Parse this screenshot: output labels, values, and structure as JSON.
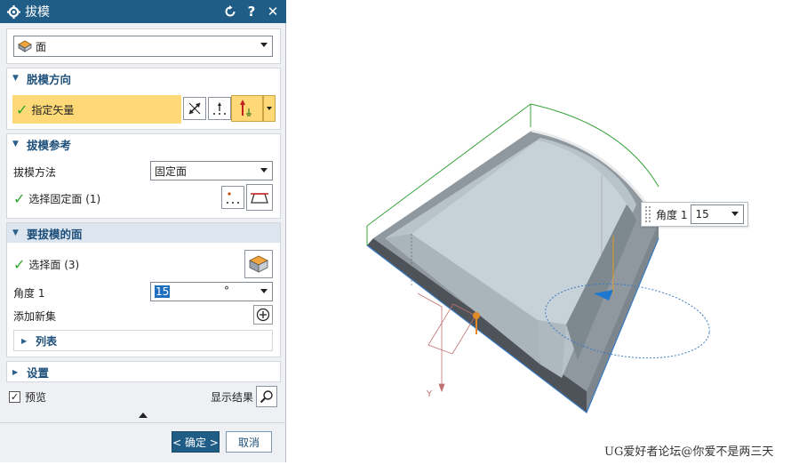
{
  "dialog": {
    "title": "拔模",
    "type_select": {
      "value": "面",
      "icon": "face-icon"
    },
    "draft_direction": {
      "header": "脱模方向",
      "specify_vector": "指定矢量",
      "icons": [
        "reverse-direction-icon",
        "vector-dialog-icon",
        "zc-axis-icon"
      ]
    },
    "draft_reference": {
      "header": "拔模参考",
      "method_label": "拔模方法",
      "method_value": "固定面",
      "select_fixed_face": "选择固定面 (1)"
    },
    "faces_to_draft": {
      "header": "要拔模的面",
      "select_face": "选择面 (3)",
      "angle_label": "角度 1",
      "angle_value": "15",
      "angle_unit": "°",
      "add_new_set": "添加新集",
      "list_label": "列表"
    },
    "settings": {
      "header": "设置"
    },
    "preview": {
      "label": "预览",
      "checked": true
    },
    "show_result": "显示结果",
    "ok_label": "< 确定 >",
    "cancel_label": "取消"
  },
  "viewport": {
    "angle_popup": {
      "label": "角度 1",
      "value": "15"
    },
    "triad_axis_label": "Y",
    "watermark": "UG爱好者论坛@你爱不是两三天"
  },
  "colors": {
    "titlebar": "#1f5c86",
    "highlight_row": "#ffd977",
    "check": "#2aa52a",
    "ok_button": "#1f5c86"
  }
}
